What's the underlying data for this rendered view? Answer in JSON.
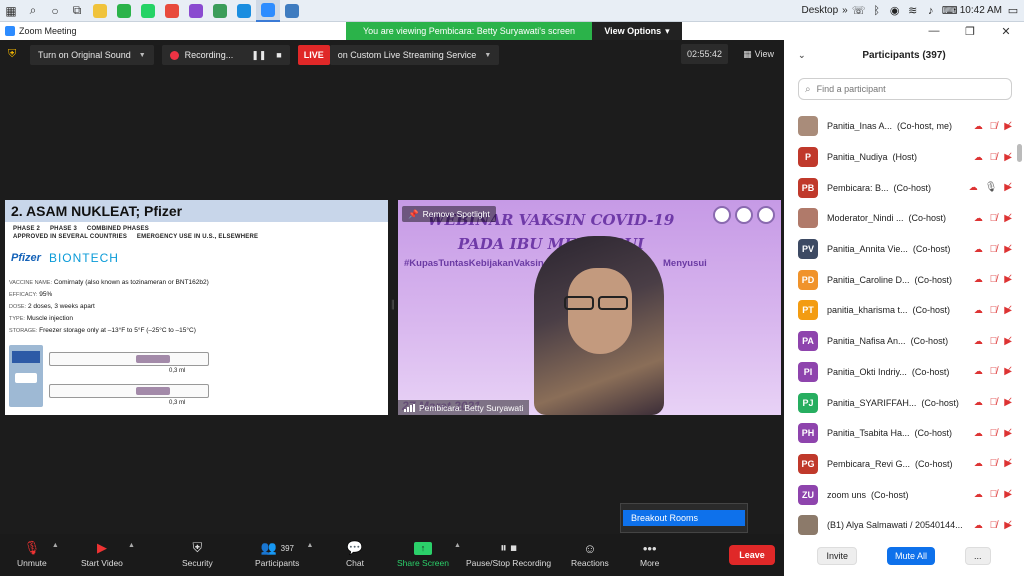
{
  "taskbar": {
    "desktop_label": "Desktop",
    "time": "10:42 AM",
    "overflow": "»",
    "apps": [
      {
        "name": "file-explorer",
        "color": "#f0c33c"
      },
      {
        "name": "android-messages",
        "color": "#2bb34a"
      },
      {
        "name": "whatsapp",
        "color": "#25d366"
      },
      {
        "name": "chrome",
        "color": "#e84a3c"
      },
      {
        "name": "onenote",
        "color": "#8a4bd0"
      },
      {
        "name": "google-meet",
        "color": "#3b9d5a"
      },
      {
        "name": "edge",
        "color": "#1b8ee0"
      },
      {
        "name": "zoom",
        "color": "#2d8cff"
      },
      {
        "name": "photos",
        "color": "#3f7cc0"
      }
    ]
  },
  "window": {
    "title": "Zoom Meeting",
    "viewing_banner": "You are viewing Pembicara: Betty Suryawati's screen",
    "view_options": "View Options"
  },
  "meeting": {
    "audio_btn": "Turn on Original Sound",
    "recording": "Recording...",
    "live_badge": "LIVE",
    "stream_btn": "on Custom Live Streaming Service",
    "timer": "02:55:42",
    "view_btn": "View"
  },
  "slide": {
    "heading": "2. ASAM NUKLEAT; Pfizer",
    "phases": [
      "PHASE 2",
      "PHASE 3",
      "COMBINED PHASES"
    ],
    "approval": [
      "APPROVED IN SEVERAL COUNTRIES",
      "EMERGENCY USE IN U.S., ELSEWHERE"
    ],
    "brand_pfizer": "Pfizer",
    "brand_biontech": "BIONTECH",
    "rows": [
      {
        "k": "VACCINE NAME:",
        "v": "Comirnaty (also known as tozinameran or BNT162b2)"
      },
      {
        "k": "EFFICACY:",
        "v": "95%"
      },
      {
        "k": "DOSE:",
        "v": "2 doses, 3 weeks apart"
      },
      {
        "k": "TYPE:",
        "v": "Muscle injection"
      },
      {
        "k": "STORAGE:",
        "v": "Freezer storage only at –13°F to 5°F (–25°C to –15°C)"
      }
    ],
    "syringe_label": "0,3 ml"
  },
  "speaker": {
    "event_title_1": "WEBINAR VAKSIN COVID-19",
    "event_title_2": "PADA IBU MENYUSUI",
    "hashtag_left": "#KupasTuntasKebijakanVaksin",
    "hashtag_right": "Menyusui",
    "remove_spotlight": "Remove Spotlight",
    "date_watermark": "27 Maret 2021",
    "name_tag": "Pembicara: Betty Suryawati"
  },
  "breakout_menu": {
    "item": "Breakout Rooms"
  },
  "toolbar": {
    "unmute": "Unmute",
    "start_video": "Start Video",
    "security": "Security",
    "participants": "Participants",
    "participants_count": "397",
    "chat": "Chat",
    "share_screen": "Share Screen",
    "pause_recording": "Pause/Stop Recording",
    "reactions": "Reactions",
    "more": "More",
    "leave": "Leave"
  },
  "panel": {
    "title": "Participants (397)",
    "search_placeholder": "Find a participant",
    "participants": [
      {
        "initials": "",
        "color": "#a98c7a",
        "name": "Panitia_Inas A...",
        "role": "(Co-host, me)",
        "video_off": true
      },
      {
        "initials": "P",
        "color": "#c0392b",
        "name": "Panitia_Nudiya",
        "role": "(Host)",
        "video_off": true
      },
      {
        "initials": "PB",
        "color": "#c0392b",
        "name": "Pembicara: B...",
        "role": "(Co-host)",
        "video_off": false
      },
      {
        "initials": "",
        "color": "#b07a6a",
        "name": "Moderator_Nindi ...",
        "role": "(Co-host)",
        "video_off": true
      },
      {
        "initials": "PV",
        "color": "#3d4a63",
        "name": "Panitia_Annita Vie...",
        "role": "(Co-host)",
        "video_off": true
      },
      {
        "initials": "PD",
        "color": "#f0932b",
        "name": "Panitia_Caroline D...",
        "role": "(Co-host)",
        "video_off": true
      },
      {
        "initials": "PT",
        "color": "#f39c12",
        "name": "panitia_kharisma t...",
        "role": "(Co-host)",
        "video_off": true
      },
      {
        "initials": "PA",
        "color": "#8e44ad",
        "name": "Panitia_Nafisa An...",
        "role": "(Co-host)",
        "video_off": true
      },
      {
        "initials": "PI",
        "color": "#8e44ad",
        "name": "Panitia_Okti Indriy...",
        "role": "(Co-host)",
        "video_off": true
      },
      {
        "initials": "PJ",
        "color": "#27ae60",
        "name": "Panitia_SYARIFFAH...",
        "role": "(Co-host)",
        "video_off": true
      },
      {
        "initials": "PH",
        "color": "#8e44ad",
        "name": "Panitia_Tsabita Ha...",
        "role": "(Co-host)",
        "video_off": true
      },
      {
        "initials": "PG",
        "color": "#c0392b",
        "name": "Pembicara_Revi G...",
        "role": "(Co-host)",
        "video_off": true
      },
      {
        "initials": "ZU",
        "color": "#8e44ad",
        "name": "zoom uns",
        "role": "(Co-host)",
        "video_off": true
      },
      {
        "initials": "",
        "color": "#8c7a6a",
        "name": "(B1) Alya Salmawati / 20540144...",
        "role": "",
        "video_off": true
      }
    ],
    "invite": "Invite",
    "mute_all": "Mute All",
    "more": "..."
  }
}
